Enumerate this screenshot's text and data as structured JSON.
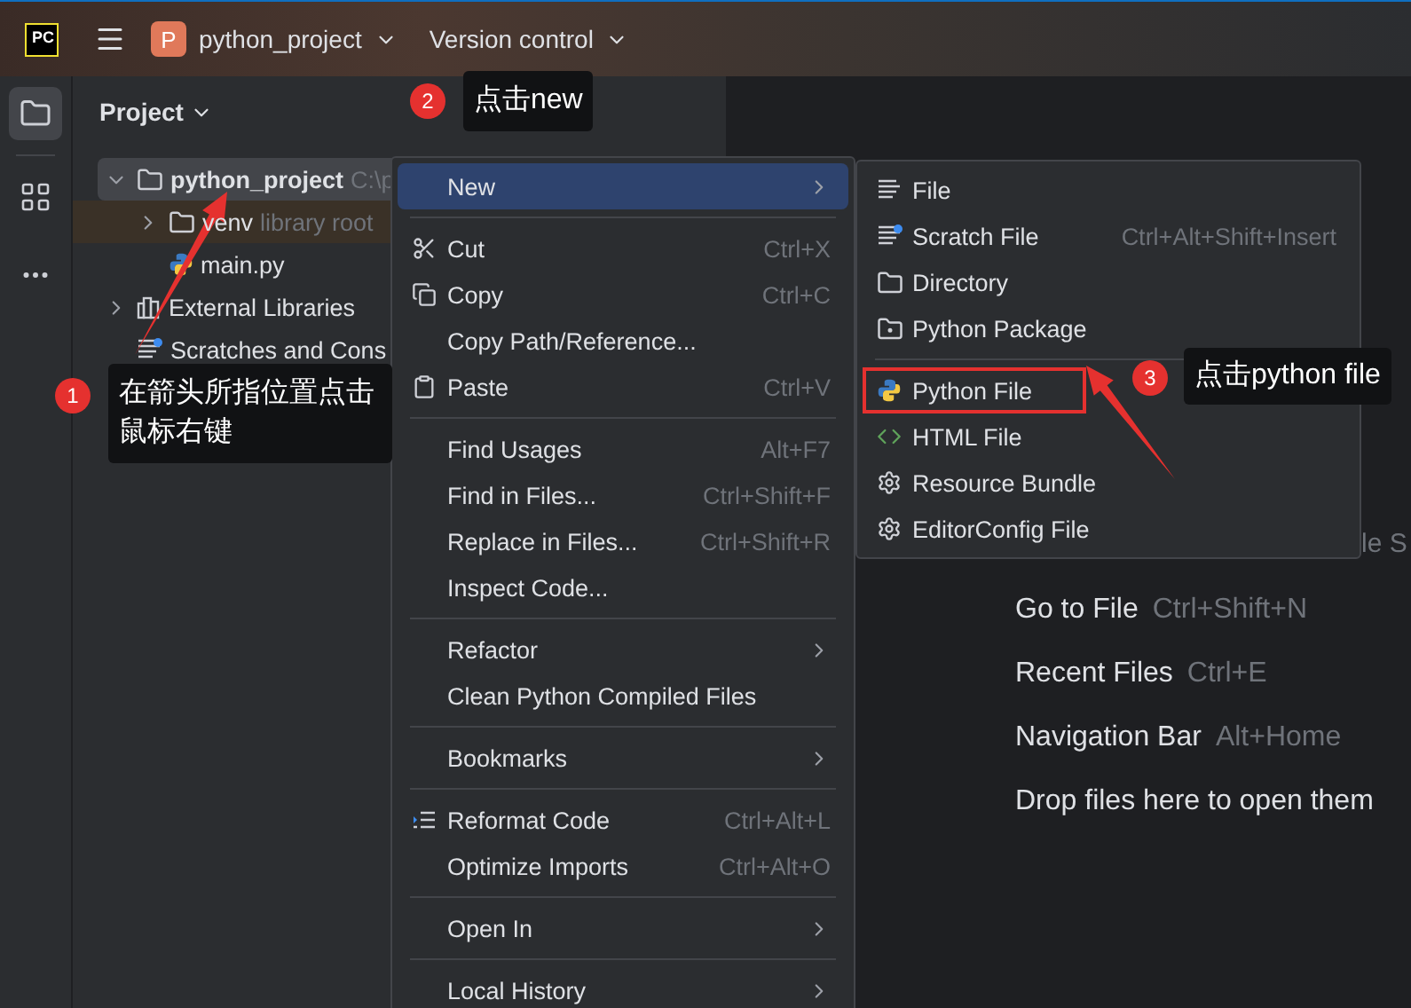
{
  "title_bar": {
    "logo_text": "PC",
    "project_initial": "P",
    "project": "python_project",
    "vcs": "Version control"
  },
  "project_panel": {
    "title": "Project",
    "tree": [
      {
        "label": "python_project",
        "hint": "C:\\p",
        "expanded": true,
        "selected": true,
        "children": [
          {
            "label": "venv",
            "hint": "library root",
            "expanded": false,
            "selected": false,
            "kind": "folder"
          },
          {
            "label": "main.py",
            "selected": false,
            "kind": "python"
          }
        ],
        "kind": "folder"
      },
      {
        "label": "External Libraries",
        "expanded": false,
        "selected": false,
        "kind": "library"
      },
      {
        "label": "Scratches and Cons",
        "selected": false,
        "kind": "scratch"
      }
    ]
  },
  "context_menu": {
    "groups": [
      [
        {
          "label": "New",
          "submenu": true,
          "selected": true
        }
      ],
      [
        {
          "label": "Cut",
          "shortcut": "Ctrl+X",
          "selected": false
        },
        {
          "label": "Copy",
          "shortcut": "Ctrl+C",
          "selected": false
        },
        {
          "label": "Copy Path/Reference...",
          "selected": false
        },
        {
          "label": "Paste",
          "shortcut": "Ctrl+V",
          "selected": false
        }
      ],
      [
        {
          "label": "Find Usages",
          "shortcut": "Alt+F7",
          "selected": false
        },
        {
          "label": "Find in Files...",
          "shortcut": "Ctrl+Shift+F",
          "selected": false
        },
        {
          "label": "Replace in Files...",
          "shortcut": "Ctrl+Shift+R",
          "selected": false
        },
        {
          "label": "Inspect Code...",
          "selected": false
        }
      ],
      [
        {
          "label": "Refactor",
          "submenu": true,
          "selected": false
        },
        {
          "label": "Clean Python Compiled Files",
          "selected": false
        }
      ],
      [
        {
          "label": "Bookmarks",
          "submenu": true,
          "selected": false
        }
      ],
      [
        {
          "label": "Reformat Code",
          "shortcut": "Ctrl+Alt+L",
          "selected": false
        },
        {
          "label": "Optimize Imports",
          "shortcut": "Ctrl+Alt+O",
          "selected": false
        }
      ],
      [
        {
          "label": "Open In",
          "submenu": true,
          "selected": false
        }
      ],
      [
        {
          "label": "Local History",
          "submenu": true,
          "selected": false
        }
      ]
    ]
  },
  "new_submenu": {
    "groups": [
      [
        {
          "label": "File",
          "marked": false
        },
        {
          "label": "Scratch File",
          "shortcut": "Ctrl+Alt+Shift+Insert",
          "marked": false
        },
        {
          "label": "Directory",
          "marked": false
        },
        {
          "label": "Python Package",
          "marked": false
        }
      ],
      [
        {
          "label": "Python File",
          "marked": true
        },
        {
          "label": "HTML File",
          "marked": false
        },
        {
          "label": "Resource Bundle",
          "marked": false
        },
        {
          "label": "EditorConfig File",
          "marked": false
        }
      ]
    ]
  },
  "editor": {
    "hidden_fragment": "le S",
    "actions": [
      {
        "label": "Go to File",
        "shortcut": "Ctrl+Shift+N"
      },
      {
        "label": "Recent Files",
        "shortcut": "Ctrl+E"
      },
      {
        "label": "Navigation Bar",
        "shortcut": "Alt+Home"
      }
    ],
    "drop_hint": "Drop files here to open them"
  },
  "callouts": [
    {
      "number": "1",
      "text": "在箭头所指位置点击鼠标右键"
    },
    {
      "number": "2",
      "text": "点击new"
    },
    {
      "number": "3",
      "text": "点击python file"
    }
  ]
}
